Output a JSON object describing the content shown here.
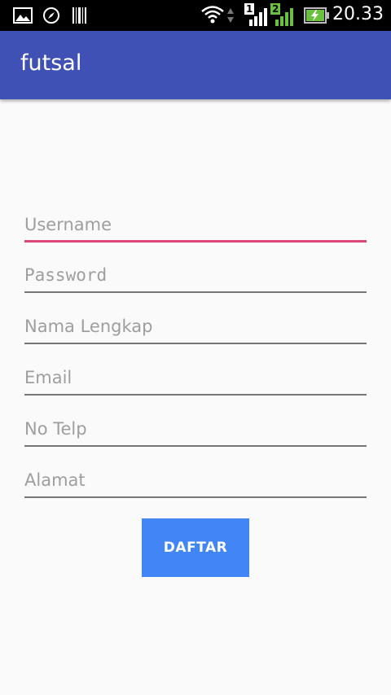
{
  "status_bar": {
    "time": "20.33",
    "icons": [
      "image-icon",
      "compass-icon",
      "barcode-icon",
      "wifi-icon",
      "signal-sim1-icon",
      "signal-sim2-icon",
      "battery-charging-icon"
    ],
    "sim1_label": "1",
    "sim2_label": "2"
  },
  "app_bar": {
    "title": "futsal",
    "color": "#3f51b5"
  },
  "form": {
    "username_placeholder": "Username",
    "password_placeholder": "Password",
    "fullname_placeholder": "Nama Lengkap",
    "email_placeholder": "Email",
    "phone_placeholder": "No Telp",
    "address_placeholder": "Alamat",
    "focus_color": "#e0457b"
  },
  "button": {
    "label": "DAFTAR",
    "color": "#4285f4"
  }
}
